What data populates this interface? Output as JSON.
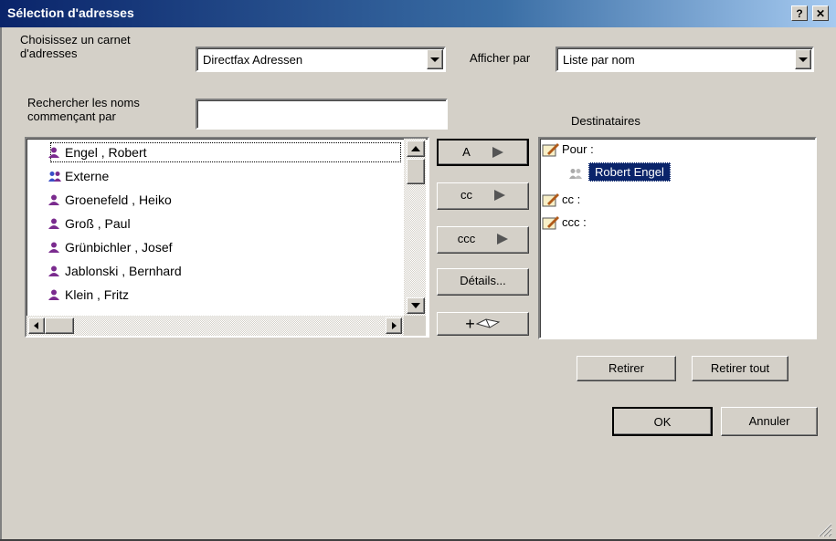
{
  "window": {
    "title": "Sélection d'adresses",
    "help_label": "?",
    "close_label": "✕"
  },
  "addressbook": {
    "label": "Choisissez un carnet d'adresses",
    "selected": "Directfax Adressen"
  },
  "view": {
    "label": "Afficher par",
    "selected": "Liste par nom"
  },
  "search": {
    "label": "Rechercher les noms commençant par",
    "value": ""
  },
  "names": [
    {
      "name": "Engel , Robert",
      "type": "person",
      "selected": true
    },
    {
      "name": "Externe",
      "type": "group"
    },
    {
      "name": "Groenefeld , Heiko",
      "type": "person"
    },
    {
      "name": "Groß , Paul",
      "type": "person"
    },
    {
      "name": "Grünbichler , Josef",
      "type": "person"
    },
    {
      "name": "Jablonski , Bernhard",
      "type": "person"
    },
    {
      "name": "Klein , Fritz",
      "type": "person"
    }
  ],
  "actions": {
    "to": "A",
    "cc": "cc",
    "bcc": "ccc",
    "details": "Détails...",
    "new": "+"
  },
  "recipients": {
    "title": "Destinataires",
    "to_label": "Pour :",
    "to_items": [
      "Robert Engel"
    ],
    "cc_label": "cc :",
    "bcc_label": "ccc :"
  },
  "buttons": {
    "remove": "Retirer",
    "remove_all": "Retirer tout",
    "ok": "OK",
    "cancel": "Annuler"
  },
  "colors": {
    "title_start": "#0a246a",
    "selection": "#0a246a",
    "person_icon": "#7a2b8e"
  }
}
